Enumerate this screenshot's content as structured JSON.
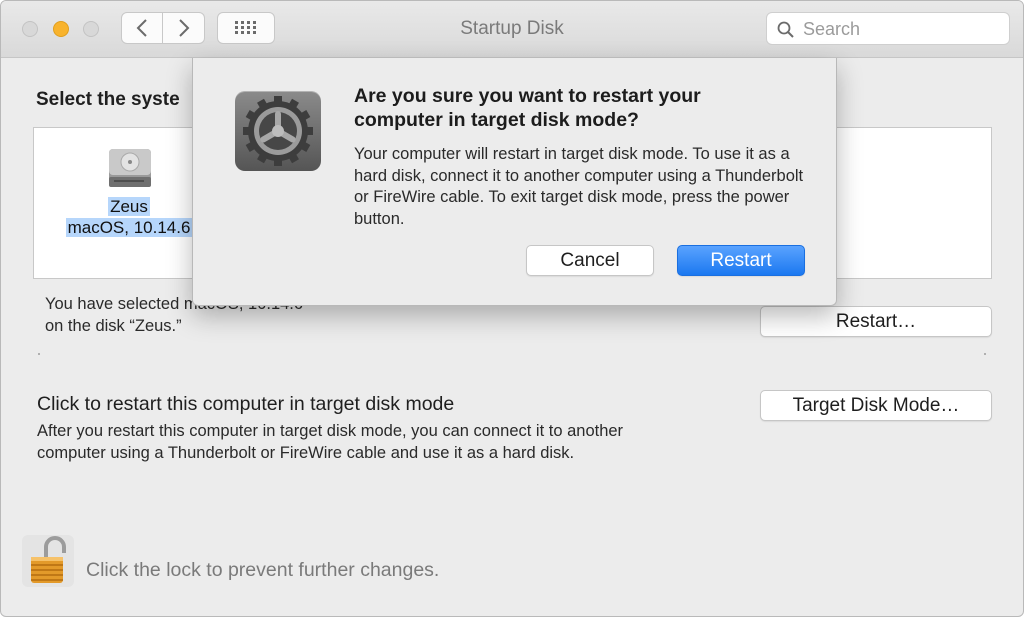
{
  "window": {
    "title": "Startup Disk",
    "search_placeholder": "Search"
  },
  "main": {
    "heading": "Select the syste",
    "disk": {
      "name": "Zeus",
      "os": "macOS, 10.14.6"
    },
    "selected_line1": "You have selected macOS, 10.14.6",
    "selected_line2": "on the disk “Zeus.”",
    "restart_button": "Restart…",
    "target_disk_title": "Click to restart this computer in target disk mode",
    "target_disk_desc": "After you restart this computer in target disk mode, you can connect it to another computer using a Thunderbolt or FireWire cable and use it as a hard disk.",
    "target_disk_button": "Target Disk Mode…",
    "lock_text": "Click the lock to prevent further changes."
  },
  "dialog": {
    "title": "Are you sure you want to restart your computer in target disk mode?",
    "body": "Your computer will restart in target disk mode. To use it as a hard disk, connect it to another computer using a Thunderbolt or FireWire cable. To exit target disk mode, press the power button.",
    "cancel": "Cancel",
    "confirm": "Restart"
  },
  "colors": {
    "accent": "#1b78f0",
    "selection": "#b6d6fb",
    "minimize": "#f8b32d"
  },
  "icons": {
    "back": "chevron-left-icon",
    "forward": "chevron-right-icon",
    "grid": "grid-icon",
    "search": "search-icon",
    "disk": "hard-disk-icon",
    "gear": "gear-icon",
    "lock": "lock-icon"
  }
}
